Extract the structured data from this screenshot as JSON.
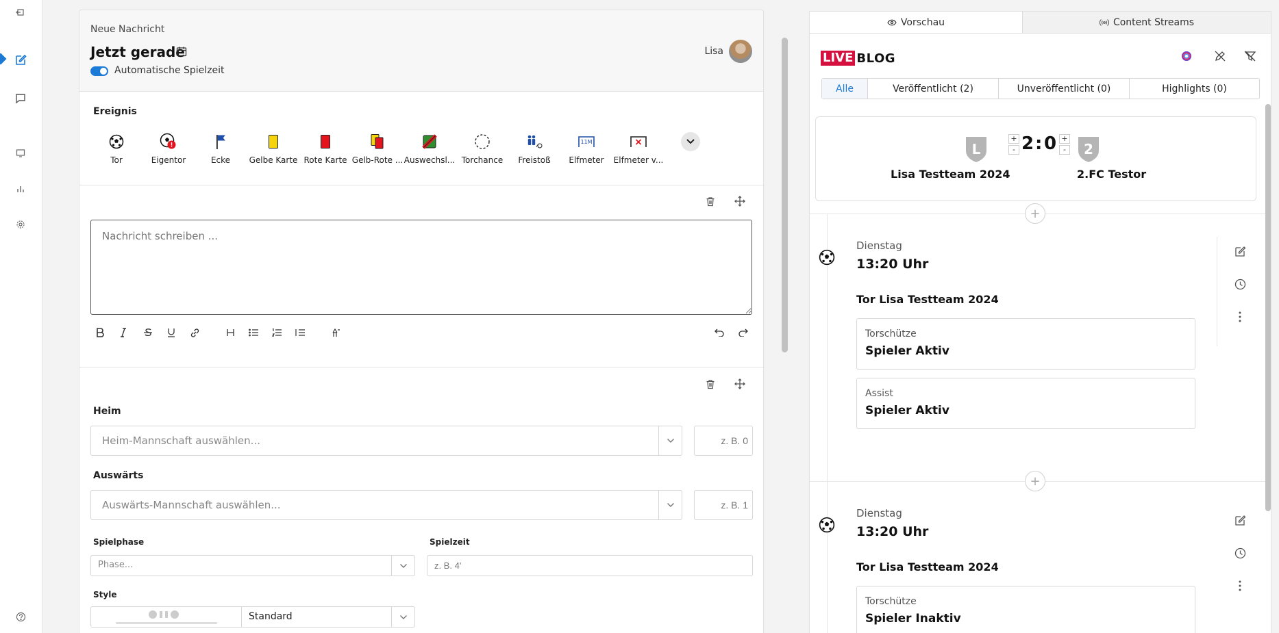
{
  "sidebar": {
    "items": [
      {
        "icon": "back-icon"
      },
      {
        "icon": "edit-icon",
        "active": true
      },
      {
        "icon": "chat-icon"
      },
      {
        "icon": "monitor-icon"
      },
      {
        "icon": "chart-icon"
      },
      {
        "icon": "settings-icon"
      },
      {
        "icon": "help-icon"
      }
    ],
    "accent": "#1c7ad6"
  },
  "editor": {
    "header": {
      "label": "Neue Nachricht",
      "title": "Jetzt gerade",
      "toggle_label": "Automatische Spielzeit",
      "toggle_on": true,
      "user": "Lisa"
    },
    "events": {
      "title": "Ereignis",
      "items": [
        {
          "label": "Tor",
          "icon": "ball-icon"
        },
        {
          "label": "Eigentor",
          "icon": "own-goal-icon"
        },
        {
          "label": "Ecke",
          "icon": "corner-flag-icon"
        },
        {
          "label": "Gelbe Karte",
          "icon": "yellow-card-icon"
        },
        {
          "label": "Rote Karte",
          "icon": "red-card-icon"
        },
        {
          "label": "Gelb-Rote ...",
          "icon": "yellow-red-card-icon"
        },
        {
          "label": "Auswechsl...",
          "icon": "substitution-icon"
        },
        {
          "label": "Torchance",
          "icon": "chance-icon"
        },
        {
          "label": "Freistoß",
          "icon": "freekick-icon"
        },
        {
          "label": "Elfmeter",
          "icon": "penalty-icon"
        },
        {
          "label": "Elfmeter v...",
          "icon": "penalty-missed-icon"
        }
      ]
    },
    "message": {
      "placeholder": "Nachricht schreiben ..."
    },
    "match": {
      "home_label": "Heim",
      "home_placeholder": "Heim-Mannschaft auswählen...",
      "home_score_placeholder": "z. B. 0",
      "away_label": "Auswärts",
      "away_placeholder": "Auswärts-Mannschaft auswählen...",
      "away_score_placeholder": "z. B. 1",
      "phase_label": "Spielphase",
      "phase_placeholder": "Phase...",
      "time_label": "Spielzeit",
      "time_placeholder": "z. B. 4'",
      "style_label": "Style",
      "style_value": "Standard"
    }
  },
  "preview": {
    "tabs": [
      {
        "label": "Vorschau",
        "active": true,
        "icon": "eye-icon"
      },
      {
        "label": "Content Streams",
        "active": false,
        "icon": "broadcast-icon"
      }
    ],
    "logo": {
      "live": "LIVE",
      "blog": "BLOG"
    },
    "filters": [
      {
        "label": "Alle",
        "active": true
      },
      {
        "label": "Veröffentlicht (2)"
      },
      {
        "label": "Unveröffentlicht (0)"
      },
      {
        "label": "Highlights (0)"
      }
    ],
    "score": {
      "home_team": "Lisa Testteam 2024",
      "home_crest_letter": "L",
      "away_team": "2.FC Testor",
      "away_crest_letter": "2",
      "home_score": "2",
      "separator": ":",
      "away_score": "0",
      "plus": "+",
      "minus": "-"
    },
    "entries": [
      {
        "day": "Dienstag",
        "time": "13:20 Uhr",
        "title": "Tor Lisa Testteam 2024",
        "cards": [
          {
            "key": "Torschütze",
            "value": "Spieler Aktiv"
          },
          {
            "key": "Assist",
            "value": "Spieler Aktiv"
          }
        ]
      },
      {
        "day": "Dienstag",
        "time": "13:20 Uhr",
        "title": "Tor Lisa Testteam 2024",
        "cards": [
          {
            "key": "Torschütze",
            "value": "Spieler Inaktiv"
          }
        ]
      }
    ],
    "brand_color": "#d6103e"
  }
}
